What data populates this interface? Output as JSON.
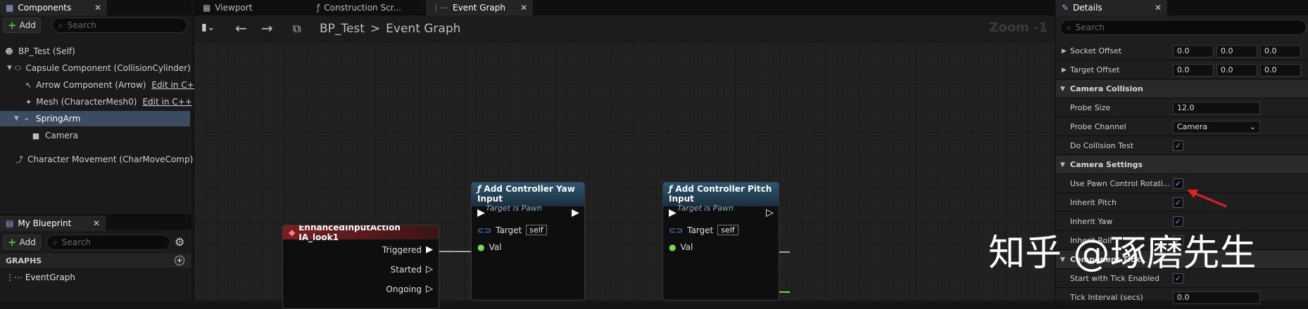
{
  "components_panel": {
    "tab_title": "Components",
    "add_label": "Add",
    "search_placeholder": "Search",
    "tree": [
      {
        "label": "BP_Test (Self)",
        "icon": "person-icon"
      },
      {
        "label": "Capsule Component (CollisionCylinder)",
        "icon": "capsule-icon"
      },
      {
        "label": "Arrow Component (Arrow)",
        "icon": "arrow-icon",
        "link": "Edit in C++"
      },
      {
        "label": "Mesh (CharacterMesh0)",
        "icon": "mesh-icon",
        "link": "Edit in C++"
      },
      {
        "label": "SpringArm",
        "icon": "springarm-icon",
        "selected": true
      },
      {
        "label": "Camera",
        "icon": "camera-icon"
      },
      {
        "label": "Character Movement (CharMoveComp)",
        "icon": "movement-icon"
      }
    ]
  },
  "my_blueprint": {
    "tab_title": "My Blueprint",
    "add_label": "Add",
    "search_placeholder": "Search",
    "graphs_header": "GRAPHS",
    "graph_item": "EventGraph"
  },
  "editor_tabs": [
    {
      "label": "Viewport",
      "icon": "viewport-icon"
    },
    {
      "label": "Construction Scr...",
      "icon": "function-icon"
    },
    {
      "label": "Event Graph",
      "icon": "graph-icon",
      "active": true
    }
  ],
  "breadcrumb": {
    "root": "BP_Test",
    "separator": ">",
    "current": "Event Graph"
  },
  "zoom_label": "Zoom -1",
  "nodes": {
    "event": {
      "title": "EnhancedInputAction IA_look1",
      "pins": [
        "Triggered",
        "Started",
        "Ongoing"
      ]
    },
    "yaw": {
      "title": "Add Controller Yaw Input",
      "subtitle": "Target is Pawn",
      "target_label": "Target",
      "self_label": "self",
      "val_label": "Val"
    },
    "pitch": {
      "title": "Add Controller Pitch Input",
      "subtitle": "Target is Pawn",
      "target_label": "Target",
      "self_label": "self",
      "val_label": "Val"
    }
  },
  "watermark": "知乎 @琢磨先生",
  "details": {
    "tab_title": "Details",
    "search_placeholder": "Search",
    "rows": [
      {
        "kind": "vector",
        "label": "Socket Offset",
        "values": [
          "0.0",
          "0.0",
          "0.0"
        ]
      },
      {
        "kind": "vector",
        "label": "Target Offset",
        "values": [
          "0.0",
          "0.0",
          "0.0"
        ]
      },
      {
        "kind": "section",
        "label": "Camera Collision"
      },
      {
        "kind": "number",
        "label": "Probe Size",
        "value": "12.0"
      },
      {
        "kind": "dropdown",
        "label": "Probe Channel",
        "value": "Camera"
      },
      {
        "kind": "check",
        "label": "Do Collision Test",
        "checked": true
      },
      {
        "kind": "section",
        "label": "Camera Settings"
      },
      {
        "kind": "check",
        "label": "Use Pawn Control Rotati...",
        "checked": true
      },
      {
        "kind": "check",
        "label": "Inherit Pitch",
        "checked": true
      },
      {
        "kind": "check",
        "label": "Inherit Yaw",
        "checked": true
      },
      {
        "kind": "check",
        "label": "Inherit Roll",
        "checked": true
      },
      {
        "kind": "section",
        "label": "Component Tick"
      },
      {
        "kind": "check",
        "label": "Start with Tick Enabled",
        "checked": true
      },
      {
        "kind": "number",
        "label": "Tick Interval (secs)",
        "value": "0.0"
      }
    ]
  },
  "colors": {
    "accent_blue": "#4aa8ff",
    "selection": "#3b4b60",
    "event_node_red": "#7a1f1f",
    "function_node_blue": "#2e5670",
    "annotation_arrow": "#e02020"
  }
}
